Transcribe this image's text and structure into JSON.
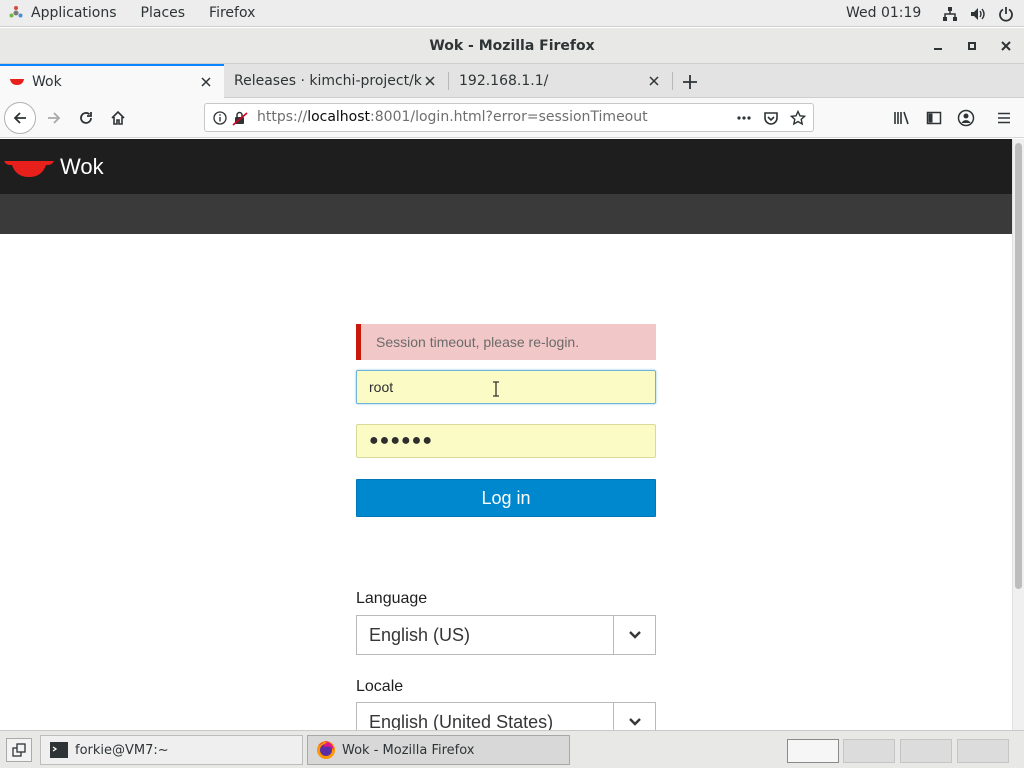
{
  "topbar": {
    "applications": "Applications",
    "places": "Places",
    "firefox": "Firefox",
    "clock": "Wed 01:19",
    "icons": [
      "network-icon",
      "volume-icon",
      "power-icon"
    ]
  },
  "window": {
    "title": "Wok - Mozilla Firefox"
  },
  "tabs": [
    {
      "label": "Wok",
      "active": true
    },
    {
      "label": "Releases · kimchi-project/kim",
      "active": false
    },
    {
      "label": "192.168.1.1/",
      "active": false
    }
  ],
  "navbar": {
    "url_prefix": "https://",
    "url_host": "localhost",
    "url_rest": ":8001/login.html?error=sessionTimeout"
  },
  "page": {
    "brand": "Wok",
    "error_message": "Session timeout, please re-login.",
    "username_value": "root",
    "password_value": "●●●●●●",
    "login_label": "Log in",
    "language_label": "Language",
    "language_value": "English (US)",
    "locale_label": "Locale",
    "locale_value": "English (United States)"
  },
  "taskbar": {
    "terminal_label": "forkie@VM7:~",
    "firefox_label": "Wok - Mozilla Firefox"
  },
  "colors": {
    "accent_blue": "#0088ce",
    "error_bg": "#f2c7c7",
    "error_border": "#c9190b",
    "header_dark": "#1e1e1e",
    "autofill_yellow": "#fbfbc6",
    "wok_red": "#e8201c"
  }
}
